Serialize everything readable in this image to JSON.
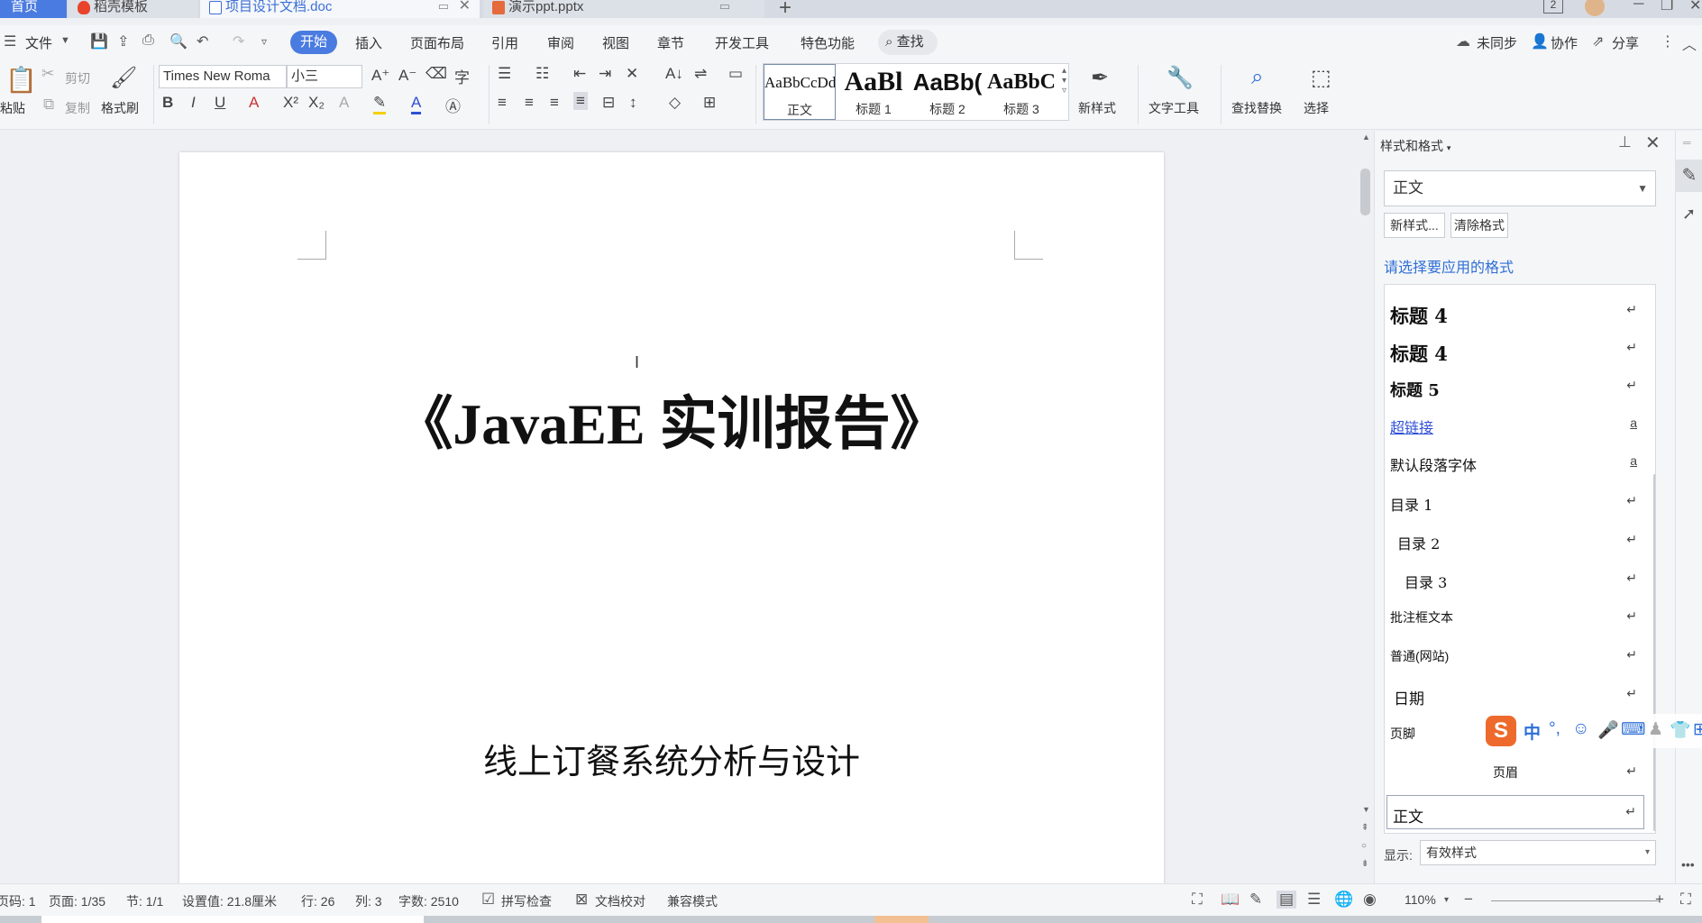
{
  "tabs": {
    "home": "首页",
    "wps_templates": "稻壳模板",
    "doc": "项目设计文档.doc",
    "ppt": "演示ppt.pptx",
    "add": "+"
  },
  "window": {
    "box_count": "2",
    "minimize": "─",
    "restore": "❐",
    "close": "✕"
  },
  "menu": {
    "file": "文件",
    "start": "开始",
    "insert": "插入",
    "layout": "页面布局",
    "references": "引用",
    "review": "审阅",
    "view": "视图",
    "chapter": "章节",
    "devtools": "开发工具",
    "special": "特色功能",
    "search": "查找",
    "sync": "未同步",
    "collab": "协作",
    "share": "分享"
  },
  "ribbon": {
    "paste": "粘贴",
    "cut": "剪切",
    "copy": "复制",
    "format_painter": "格式刷",
    "font_name": "Times New Roma",
    "font_size": "小三",
    "new_style": "新样式",
    "text_tools": "文字工具",
    "find_replace": "查找替换",
    "select": "选择"
  },
  "style_gallery": [
    {
      "preview": "AaBbCcDd",
      "label": "正文"
    },
    {
      "preview": "AaBl",
      "label": "标题 1"
    },
    {
      "preview": "AaBb(",
      "label": "标题 2"
    },
    {
      "preview": "AaBbC",
      "label": "标题 3"
    }
  ],
  "document": {
    "title": "《JavaEE 实训报告》",
    "subtitle": "线上订餐系统分析与设计"
  },
  "panel": {
    "title": "样式和格式",
    "current_style": "正文",
    "new_style_btn": "新样式...",
    "clear_format_btn": "清除格式",
    "prompt": "请选择要应用的格式",
    "show_label": "显示:",
    "show_value": "有效样式",
    "styles": [
      {
        "name": "标题  4",
        "mark": "↵"
      },
      {
        "name": "标题 4",
        "mark": "↵"
      },
      {
        "name": "标题 5",
        "mark": "↵"
      },
      {
        "name": "超链接",
        "mark": "a"
      },
      {
        "name": "默认段落字体",
        "mark": "a"
      },
      {
        "name": "目录  1",
        "mark": "↵"
      },
      {
        "name": "目录  2",
        "mark": "↵"
      },
      {
        "name": "目录  3",
        "mark": "↵"
      },
      {
        "name": "批注框文本",
        "mark": "↵"
      },
      {
        "name": "普通(网站)",
        "mark": "↵"
      },
      {
        "name": "日期",
        "mark": "↵"
      },
      {
        "name": "页脚",
        "mark": ""
      },
      {
        "name": "页眉",
        "mark": "↵"
      },
      {
        "name": "正文",
        "mark": "↵"
      }
    ]
  },
  "ime": {
    "logo": "S",
    "mode": "中"
  },
  "status": {
    "page_code": "页码: 1",
    "page": "页面: 1/35",
    "section": "节: 1/1",
    "setting": "设置值: 21.8厘米",
    "row": "行: 26",
    "col": "列: 3",
    "word_count": "字数: 2510",
    "spell_check": "拼写检查",
    "doc_proof": "文档校对",
    "compat": "兼容模式",
    "zoom": "110%"
  },
  "colors": {
    "accent": "#4a7be0",
    "link": "#2f6fd6",
    "page": "#ffffff",
    "workspace": "#eef0f3"
  }
}
